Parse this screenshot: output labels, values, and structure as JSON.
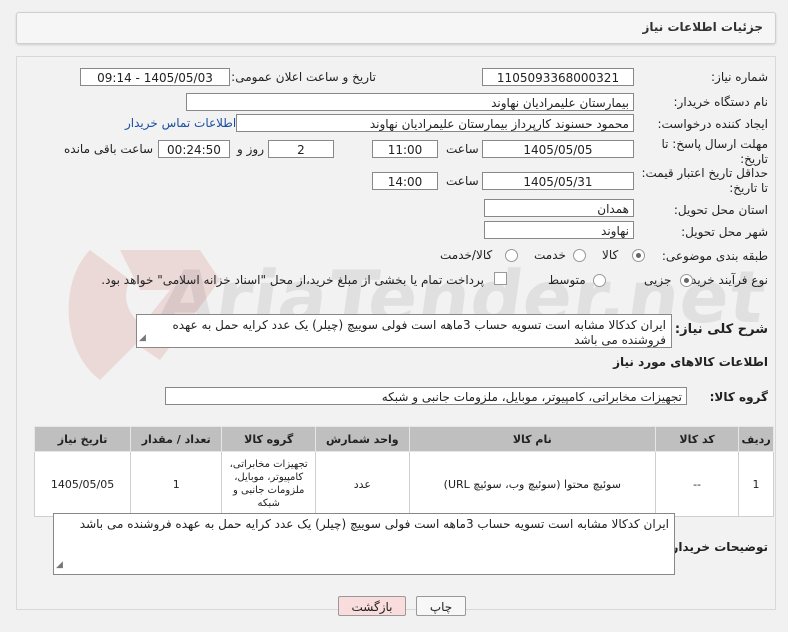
{
  "header": {
    "title": "جزئیات اطلاعات نیاز"
  },
  "fields": {
    "need_number_label": "شماره نیاز:",
    "need_number": "1105093368000321",
    "announce_label": "تاریخ و ساعت اعلان عمومی:",
    "announce_value": "1405/05/03 - 09:14",
    "buyer_label": "نام دستگاه خریدار:",
    "buyer_value": "بیمارستان علیمرادیان نهاوند",
    "creator_label": "ایجاد کننده درخواست:",
    "creator_value": "محمود حسنوند کارپرداز بیمارستان علیمرادیان نهاوند",
    "contact_link": "اطلاعات تماس خریدار",
    "deadline_label": "مهلت ارسال پاسخ: تا تاریخ:",
    "deadline_date": "1405/05/05",
    "time_label": "ساعت",
    "deadline_time": "11:00",
    "days_value": "2",
    "days_label": "روز و",
    "remaining_value": "00:24:50",
    "remaining_label": "ساعت باقی مانده",
    "validity_label": "حداقل تاریخ اعتبار قیمت: تا تاریخ:",
    "validity_date": "1405/05/31",
    "validity_time_label": "ساعت",
    "validity_time": "14:00",
    "province_label": "استان محل تحویل:",
    "province_value": "همدان",
    "city_label": "شهر محل تحویل:",
    "city_value": "نهاوند",
    "category_label": "طبقه بندی موضوعی:",
    "category_options": [
      "کالا",
      "خدمت",
      "کالا/خدمت"
    ],
    "process_label": "نوع فرآیند خرید :",
    "process_options": [
      "جزیی",
      "متوسط"
    ],
    "payment_note": "پرداخت تمام یا بخشی از مبلغ خرید،از محل \"اسناد خزانه اسلامی\" خواهد بود."
  },
  "description": {
    "label": "شرح کلی نیاز:",
    "text": "ایران کدکالا مشابه است تسویه حساب 3ماهه است فولی سوییچ (چیلر) یک عدد کرایه حمل به عهده فروشنده می باشد"
  },
  "goods": {
    "section_title": "اطلاعات کالاهای مورد نیاز",
    "group_label": "گروه کالا:",
    "group_value": "تجهیزات مخابراتی، کامپیوتر، موبایل، ملزومات جانبی و شبکه",
    "columns": [
      "ردیف",
      "کد کالا",
      "نام کالا",
      "واحد شمارش",
      "گروه کالا",
      "تعداد / مقدار",
      "تاریخ نیاز"
    ],
    "rows": [
      {
        "row": "1",
        "code": "--",
        "name": "سوئیچ محتوا (سوئیچ وب، سوئیچ URL)",
        "unit": "عدد",
        "group": "تجهیزات مخابراتی، کامپیوتر، موبایل، ملزومات جانبی و شبکه",
        "qty": "1",
        "date": "1405/05/05"
      }
    ]
  },
  "buyer_notes": {
    "label": "توضیحات خریدار:",
    "text": "ایران کدکالا مشابه است تسویه حساب 3ماهه است فولی سوییچ (چیلر) یک عدد کرایه حمل به عهده فروشنده می باشد"
  },
  "buttons": {
    "print": "چاپ",
    "back": "بازگشت"
  },
  "watermark": {
    "text": "AriaTender.net"
  },
  "colors": {
    "link": "#1a4fa0",
    "back_button_bg": "#f9dcdc",
    "table_header": "#bfbfbf"
  }
}
